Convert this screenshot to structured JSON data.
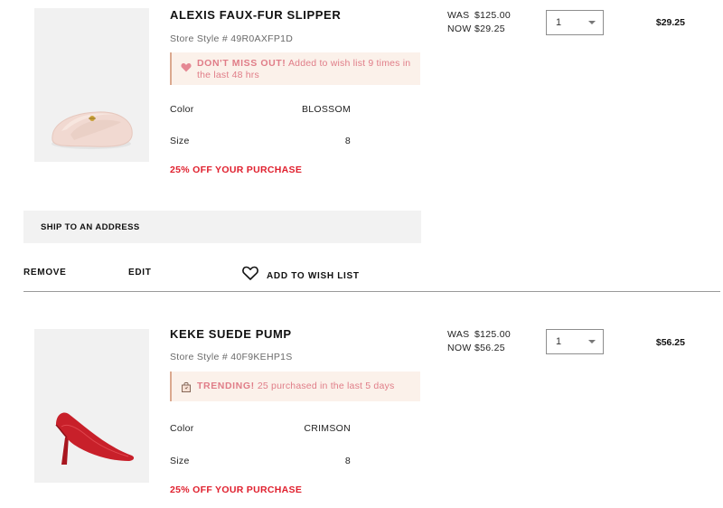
{
  "items": [
    {
      "name": "ALEXIS FAUX-FUR SLIPPER",
      "style_line": "Store Style # 49R0AXFP1D",
      "promo": {
        "icon": "heart-icon",
        "lead": "DON'T MISS OUT!",
        "text": " Added to wish list 9 times in the last 48 hrs"
      },
      "color_label": "Color",
      "color_value": "BLOSSOM",
      "size_label": "Size",
      "size_value": "8",
      "discount": "25% OFF YOUR PURCHASE",
      "was_label": "WAS",
      "was_price": "$125.00",
      "now_label": "NOW",
      "now_price": "$29.25",
      "qty": "1",
      "total": "$29.25"
    },
    {
      "name": "KEKE SUEDE PUMP",
      "style_line": "Store Style # 40F9KEHP1S",
      "promo": {
        "icon": "trending-bag-icon",
        "lead": "TRENDING!",
        "text": " 25 purchased in the last 5 days"
      },
      "color_label": "Color",
      "color_value": "CRIMSON",
      "size_label": "Size",
      "size_value": "8",
      "discount": "25% OFF YOUR PURCHASE",
      "was_label": "WAS",
      "was_price": "$125.00",
      "now_label": "NOW",
      "now_price": "$56.25",
      "qty": "1",
      "total": "$56.25"
    }
  ],
  "shipping": {
    "label": "SHIP TO AN ADDRESS"
  },
  "actions": {
    "remove": "REMOVE",
    "edit": "EDIT",
    "wishlist": "ADD TO WISH LIST",
    "wishlist_icon": "heart-outline-icon"
  },
  "colors": {
    "promo_background": "#fbf1ea",
    "promo_text": "#e07d88",
    "discount_red": "#e0202e",
    "slipper_pink": "#f3ddd6",
    "pump_red": "#c8202a"
  }
}
